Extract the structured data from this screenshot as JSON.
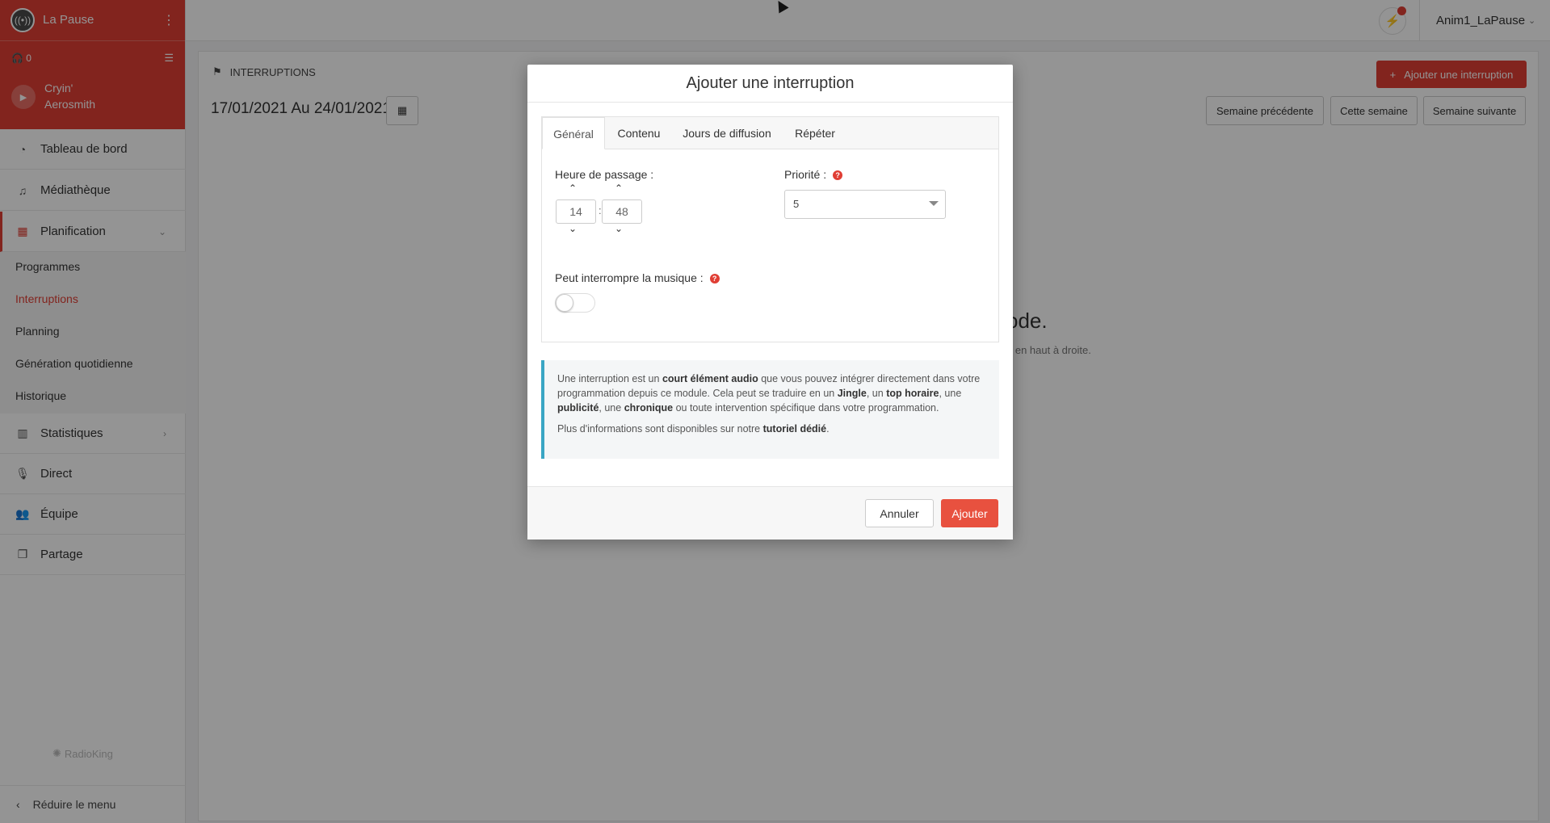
{
  "sidebar": {
    "station_name": "La Pause",
    "listeners": "0",
    "track_title": "Cryin'",
    "track_artist": "Aerosmith",
    "nav": [
      {
        "label": "Tableau de bord",
        "icon": "dashboard-icon"
      },
      {
        "label": "Médiathèque",
        "icon": "music-icon"
      },
      {
        "label": "Planification",
        "icon": "calendar-icon"
      },
      {
        "label": "Statistiques",
        "icon": "chart-icon"
      },
      {
        "label": "Direct",
        "icon": "mic-icon"
      },
      {
        "label": "Équipe",
        "icon": "users-icon"
      },
      {
        "label": "Partage",
        "icon": "share-icon"
      }
    ],
    "submenu": [
      "Programmes",
      "Interruptions",
      "Planning",
      "Génération quotidienne",
      "Historique"
    ],
    "brand": "RadioKing",
    "reduce_label": "Réduire le menu"
  },
  "topbar": {
    "username": "Anim1_LaPause"
  },
  "page": {
    "title": "INTERRUPTIONS",
    "add_button": "Ajouter une interruption",
    "date_range": "17/01/2021 Au 24/01/2021",
    "prev_week": "Semaine précédente",
    "this_week": "Cette semaine",
    "next_week": "Semaine suivante",
    "empty_fragment_a": "ode.",
    "empty_fragment_b": "n en haut à droite."
  },
  "modal": {
    "title": "Ajouter une interruption",
    "tabs": [
      "Général",
      "Contenu",
      "Jours de diffusion",
      "Répéter"
    ],
    "time_label": "Heure de passage :",
    "hour": "14",
    "minute": "48",
    "priority_label": "Priorité :",
    "priority_value": "5",
    "interrupt_label": "Peut interrompre la musique :",
    "interrupt_on": false,
    "info": {
      "p1_a": "Une interruption est un ",
      "p1_b": "court élément audio",
      "p1_c": " que vous pouvez intégrer directement dans votre programmation depuis ce module. Cela peut se traduire en un ",
      "p1_d": "Jingle",
      "p1_e": ", un ",
      "p1_f": "top horaire",
      "p1_g": ", une ",
      "p1_h": "publicité",
      "p1_i": ", une ",
      "p1_j": "chronique",
      "p1_k": " ou toute intervention spécifique dans votre programmation.",
      "p2_a": "Plus d'informations sont disponibles sur notre ",
      "p2_b": "tutoriel dédié",
      "p2_c": "."
    },
    "cancel": "Annuler",
    "submit": "Ajouter"
  },
  "colors": {
    "accent": "#e03e34",
    "info_border": "#3aa6c4"
  }
}
